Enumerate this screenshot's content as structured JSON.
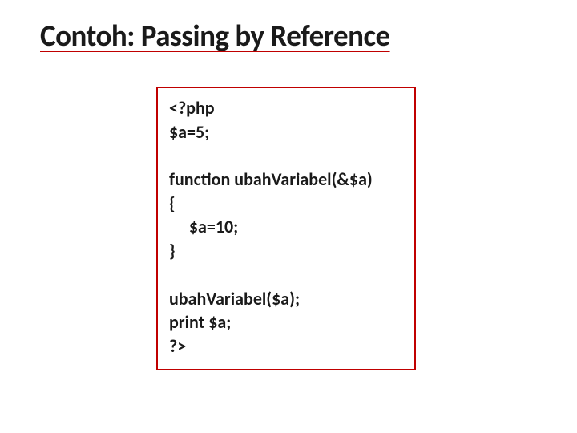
{
  "title": "Contoh: Passing by Reference",
  "code": "<?php\n$a=5;\n\nfunction ubahVariabel(&$a)\n{\n     $a=10;\n}\n\nubahVariabel($a);\nprint $a;\n?>"
}
